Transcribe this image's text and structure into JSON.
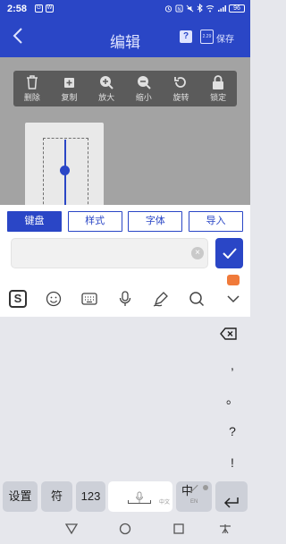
{
  "status_bar": {
    "time": "2:58",
    "left_icons": [
      "G",
      "W"
    ],
    "battery": "96",
    "icons": [
      "alarm-icon",
      "nfc-icon",
      "silent-icon",
      "bluetooth-icon",
      "wifi-icon",
      "signal-icon",
      "battery-icon"
    ]
  },
  "header": {
    "title": "编辑",
    "save_icon_text": "2.29",
    "save_label": "保存",
    "icons": [
      "back-icon",
      "help-icon",
      "save-icon"
    ]
  },
  "toolbar": {
    "items": [
      {
        "label": "删除",
        "icon": "trash-icon"
      },
      {
        "label": "复制",
        "icon": "copy-icon"
      },
      {
        "label": "放大",
        "icon": "zoom-in-icon"
      },
      {
        "label": "缩小",
        "icon": "zoom-out-icon"
      },
      {
        "label": "旋转",
        "icon": "rotate-icon"
      },
      {
        "label": "锁定",
        "icon": "lock-icon"
      }
    ]
  },
  "tabs": [
    {
      "label": "键盘",
      "active": true
    },
    {
      "label": "样式",
      "active": false
    },
    {
      "label": "字体",
      "active": false
    },
    {
      "label": "导入",
      "active": false
    }
  ],
  "input": {
    "value": "",
    "placeholder": ""
  },
  "ime_bar": {
    "icons": [
      "sogou-logo-icon",
      "emoji-icon",
      "keyboard-icon",
      "microphone-icon",
      "handwriting-icon",
      "search-icon",
      "collapse-keyboard-icon"
    ]
  },
  "keyboard": {
    "punctuation": [
      ",",
      "。",
      "?",
      "!"
    ],
    "settings": "设置",
    "symbols": "符",
    "numbers": "123",
    "space_sub": "中文",
    "lang_main": "中",
    "lang_sub": "EN",
    "icons": [
      "backspace-icon",
      "space-mic-icon",
      "enter-icon"
    ]
  },
  "colors": {
    "primary": "#2a46c6",
    "canvas_bg": "#a3a3a3",
    "keyboard_bg": "#e6e7ec",
    "toolbar_bg": "#5b5b5b"
  }
}
